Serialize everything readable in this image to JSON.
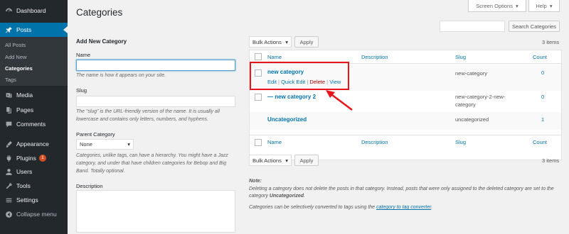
{
  "sidebar": {
    "dashboard": "Dashboard",
    "posts": "Posts",
    "sub": [
      "All Posts",
      "Add New",
      "Categories",
      "Tags"
    ],
    "media": "Media",
    "pages": "Pages",
    "comments": "Comments",
    "appearance": "Appearance",
    "plugins": "Plugins",
    "plugins_badge": "1",
    "users": "Users",
    "tools": "Tools",
    "settings": "Settings",
    "collapse": "Collapse menu"
  },
  "header": {
    "title": "Categories",
    "screen_options": "Screen Options",
    "help": "Help"
  },
  "form": {
    "title": "Add New Category",
    "name_label": "Name",
    "name_value": "",
    "name_help": "The name is how it appears on your site.",
    "slug_label": "Slug",
    "slug_value": "",
    "slug_help": "The “slug” is the URL-friendly version of the name. It is usually all lowercase and contains only letters, numbers, and hyphens.",
    "parent_label": "Parent Category",
    "parent_value": "None",
    "parent_help": "Categories, unlike tags, can have a hierarchy. You might have a Jazz category, and under that have children categories for Bebop and Big Band. Totally optional.",
    "description_label": "Description"
  },
  "list": {
    "search_button": "Search Categories",
    "bulk_actions": "Bulk Actions",
    "apply": "Apply",
    "items_count": "3 items",
    "columns": [
      "Name",
      "Description",
      "Slug",
      "Count"
    ],
    "rows": [
      {
        "name": "new category",
        "slug": "new-category",
        "count": "0",
        "actions": [
          "Edit",
          "Quick Edit",
          "Delete",
          "View"
        ]
      },
      {
        "name": "— new category 2",
        "slug": "new-category-2-new-category",
        "count": "0"
      },
      {
        "name": "Uncategorized",
        "slug": "uncategorized",
        "count": "1"
      }
    ]
  },
  "note": {
    "heading": "Note:",
    "text1": "Deleting a category does not delete the posts in that category. Instead, posts that were only assigned to the deleted category are set to the category",
    "text1_bold": "Uncategorized",
    "text2": "Categories can be selectively converted to tags using the",
    "link": "category to tag converter"
  },
  "colors": {
    "sidebar_bg": "#23282d",
    "active_blue": "#0073aa",
    "highlight_red": "#e8141b"
  }
}
